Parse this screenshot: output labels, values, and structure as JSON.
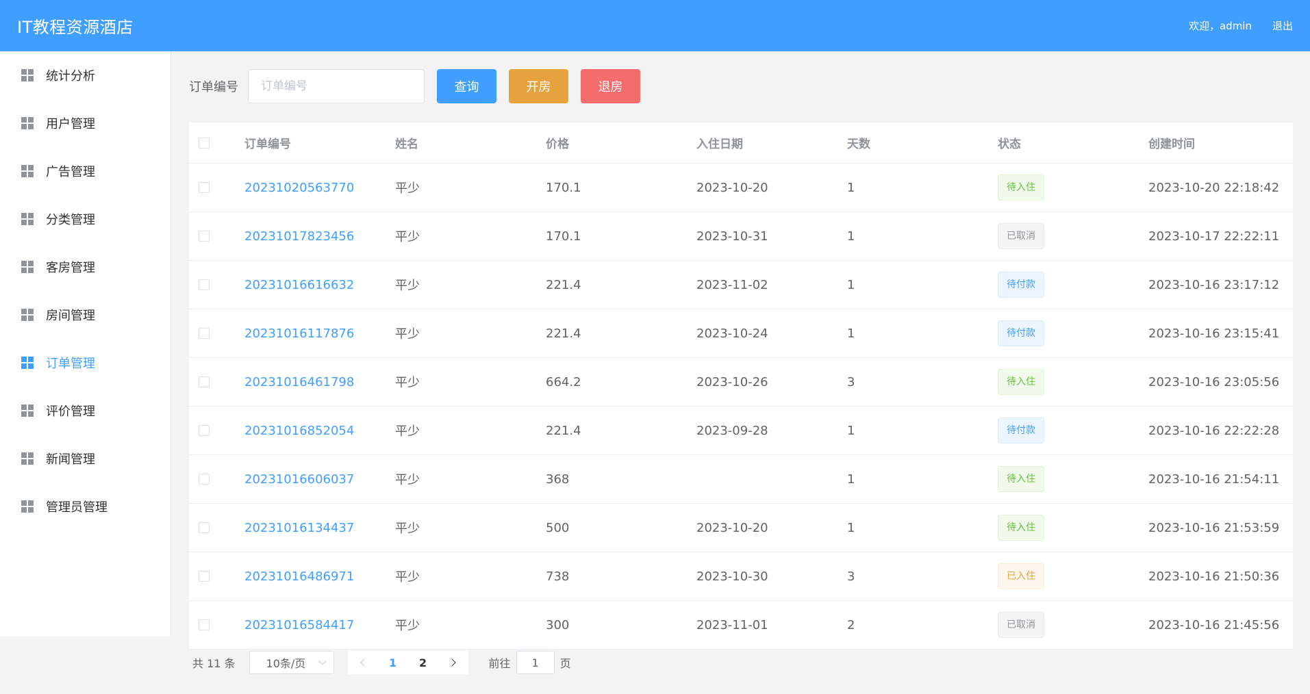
{
  "header": {
    "title": "IT教程资源酒店",
    "welcome": "欢迎，admin",
    "logout": "退出"
  },
  "sidebar": {
    "items": [
      {
        "label": "统计分析",
        "icon": "grid-icon"
      },
      {
        "label": "用户管理",
        "icon": "grid-icon"
      },
      {
        "label": "广告管理",
        "icon": "grid-icon"
      },
      {
        "label": "分类管理",
        "icon": "grid-icon"
      },
      {
        "label": "客房管理",
        "icon": "grid-icon"
      },
      {
        "label": "房间管理",
        "icon": "grid-icon"
      },
      {
        "label": "订单管理",
        "icon": "grid-icon",
        "active": true
      },
      {
        "label": "评价管理",
        "icon": "grid-icon"
      },
      {
        "label": "新闻管理",
        "icon": "grid-icon"
      },
      {
        "label": "管理员管理",
        "icon": "grid-icon"
      }
    ]
  },
  "toolbar": {
    "label": "订单编号",
    "placeholder": "订单编号",
    "query_label": "查询",
    "checkin_label": "开房",
    "checkout_label": "退房"
  },
  "table": {
    "headers": [
      "订单编号",
      "姓名",
      "价格",
      "入住日期",
      "天数",
      "状态",
      "创建时间"
    ],
    "rows": [
      {
        "no": "20231020563770",
        "name": "平少",
        "price": "170.1",
        "date": "2023-10-20",
        "days": "1",
        "status": "待入住",
        "status_type": "success",
        "created": "2023-10-20 22:18:42"
      },
      {
        "no": "20231017823456",
        "name": "平少",
        "price": "170.1",
        "date": "2023-10-31",
        "days": "1",
        "status": "已取消",
        "status_type": "info",
        "created": "2023-10-17 22:22:11"
      },
      {
        "no": "20231016616632",
        "name": "平少",
        "price": "221.4",
        "date": "2023-11-02",
        "days": "1",
        "status": "待付款",
        "status_type": "primary",
        "created": "2023-10-16 23:17:12"
      },
      {
        "no": "20231016117876",
        "name": "平少",
        "price": "221.4",
        "date": "2023-10-24",
        "days": "1",
        "status": "待付款",
        "status_type": "primary",
        "created": "2023-10-16 23:15:41"
      },
      {
        "no": "20231016461798",
        "name": "平少",
        "price": "664.2",
        "date": "2023-10-26",
        "days": "3",
        "status": "待入住",
        "status_type": "success",
        "created": "2023-10-16 23:05:56"
      },
      {
        "no": "20231016852054",
        "name": "平少",
        "price": "221.4",
        "date": "2023-09-28",
        "days": "1",
        "status": "待付款",
        "status_type": "primary",
        "created": "2023-10-16 22:22:28"
      },
      {
        "no": "20231016606037",
        "name": "平少",
        "price": "368",
        "date": "",
        "days": "1",
        "status": "待入住",
        "status_type": "success",
        "created": "2023-10-16 21:54:11"
      },
      {
        "no": "20231016134437",
        "name": "平少",
        "price": "500",
        "date": "2023-10-20",
        "days": "1",
        "status": "待入住",
        "status_type": "success",
        "created": "2023-10-16 21:53:59"
      },
      {
        "no": "20231016486971",
        "name": "平少",
        "price": "738",
        "date": "2023-10-30",
        "days": "3",
        "status": "已入住",
        "status_type": "warning",
        "created": "2023-10-16 21:50:36"
      },
      {
        "no": "20231016584417",
        "name": "平少",
        "price": "300",
        "date": "2023-11-01",
        "days": "2",
        "status": "已取消",
        "status_type": "info",
        "created": "2023-10-16 21:45:56"
      }
    ]
  },
  "pagination": {
    "total": "共 11 条",
    "page_size": "10条/页",
    "pages": [
      "1",
      "2"
    ],
    "current": "1",
    "goto_prefix": "前往",
    "goto_value": "1",
    "goto_suffix": "页"
  },
  "colors": {
    "primary": "#409eff",
    "warning": "#e6a23c",
    "danger": "#f56c6c",
    "success": "#67c23a"
  }
}
